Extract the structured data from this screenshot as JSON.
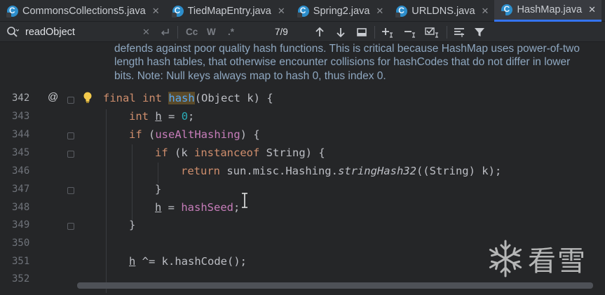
{
  "tabs": [
    {
      "label": "CommonsCollections5.java",
      "active": false
    },
    {
      "label": "TiedMapEntry.java",
      "active": false
    },
    {
      "label": "Spring2.java",
      "active": false
    },
    {
      "label": "URLDNS.java",
      "active": false
    },
    {
      "label": "HashMap.java",
      "active": true
    }
  ],
  "tab_close_glyph": "✕",
  "search": {
    "query": "readObject",
    "match_case": "Cc",
    "words": "W",
    "regex": ".*",
    "result": "7/9"
  },
  "doc_comment": [
    "defends against poor quality hash functions. This is critical because HashMap uses power-of-two",
    "length hash tables, that otherwise encounter collisions for hashCodes that do not differ in lower",
    "bits. Note: Null keys always map to hash 0, thus index 0."
  ],
  "line_numbers": [
    "342",
    "343",
    "344",
    "345",
    "346",
    "347",
    "348",
    "349",
    "350",
    "351",
    "352"
  ],
  "current_line": "342",
  "override_marker": "@",
  "code": {
    "l342": {
      "kw1": "final",
      "kw2": "int",
      "name": "hash",
      "rest": "(Object k) {"
    },
    "l343": {
      "kw": "int",
      "var": "h",
      "op": " = ",
      "num": "0",
      "end": ";"
    },
    "l344": {
      "kw": "if",
      "open": " (",
      "fld": "useAltHashing",
      "close": ") {"
    },
    "l345": {
      "kw": "if",
      "a": " (k ",
      "kw2": "instanceof",
      "b": " String) {"
    },
    "l346": {
      "kw": "return",
      "a": " sun.misc.Hashing.",
      "call": "stringHash32",
      "b": "((String) k);"
    },
    "l347": {
      "text": "}"
    },
    "l348": {
      "var": "h",
      "op": " = ",
      "fld": "hashSeed",
      "end": ";"
    },
    "l349": {
      "text": "}"
    },
    "l351": {
      "var": "h",
      "a": " ^= k.hashCode();"
    }
  },
  "watermark": "看雪",
  "colors": {
    "keyword": "#cf8e6d",
    "method": "#56a8f5",
    "field": "#c77dba",
    "number": "#2aacb8",
    "accent": "#3574f0"
  }
}
